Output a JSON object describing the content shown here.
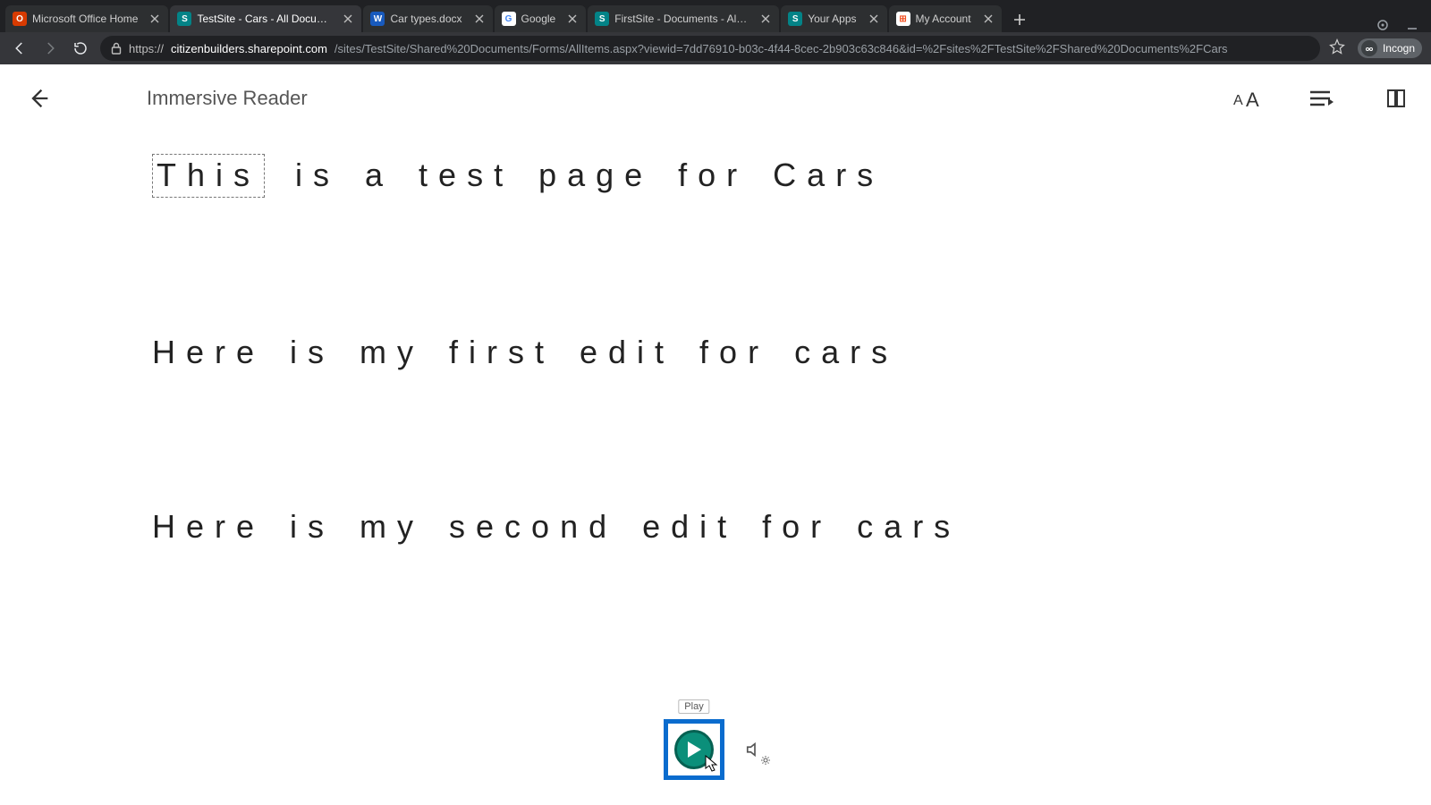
{
  "browser": {
    "tabs": [
      {
        "title": "Microsoft Office Home",
        "favicon_bg": "#d83b01",
        "favicon_fg": "#ffffff",
        "favicon_glyph": "O",
        "active": false
      },
      {
        "title": "TestSite - Cars - All Documents",
        "favicon_bg": "#038387",
        "favicon_fg": "#ffffff",
        "favicon_glyph": "S",
        "active": true
      },
      {
        "title": "Car types.docx",
        "favicon_bg": "#185abd",
        "favicon_fg": "#ffffff",
        "favicon_glyph": "W",
        "active": false
      },
      {
        "title": "Google",
        "favicon_bg": "#ffffff",
        "favicon_fg": "#4285f4",
        "favicon_glyph": "G",
        "active": false
      },
      {
        "title": "FirstSite - Documents - All Docu…",
        "favicon_bg": "#038387",
        "favicon_fg": "#ffffff",
        "favicon_glyph": "S",
        "active": false
      },
      {
        "title": "Your Apps",
        "favicon_bg": "#038387",
        "favicon_fg": "#ffffff",
        "favicon_glyph": "S",
        "active": false
      },
      {
        "title": "My Account",
        "favicon_bg": "#ffffff",
        "favicon_fg": "#f25022",
        "favicon_glyph": "⊞",
        "active": false
      }
    ],
    "url_scheme": "https://",
    "url_host": "citizenbuilders.sharepoint.com",
    "url_path": "/sites/TestSite/Shared%20Documents/Forms/AllItems.aspx?viewid=7dd76910-b03c-4f44-8cec-2b903c63c846&id=%2Fsites%2FTestSite%2FShared%20Documents%2FCars",
    "incognito_label": "Incogn"
  },
  "reader": {
    "title": "Immersive Reader",
    "line1_first_word": "This",
    "line1_rest": " is a test page for Cars",
    "line2": "Here is my first edit for cars",
    "line3": "Here is my second edit for cars",
    "play_tooltip": "Play"
  }
}
